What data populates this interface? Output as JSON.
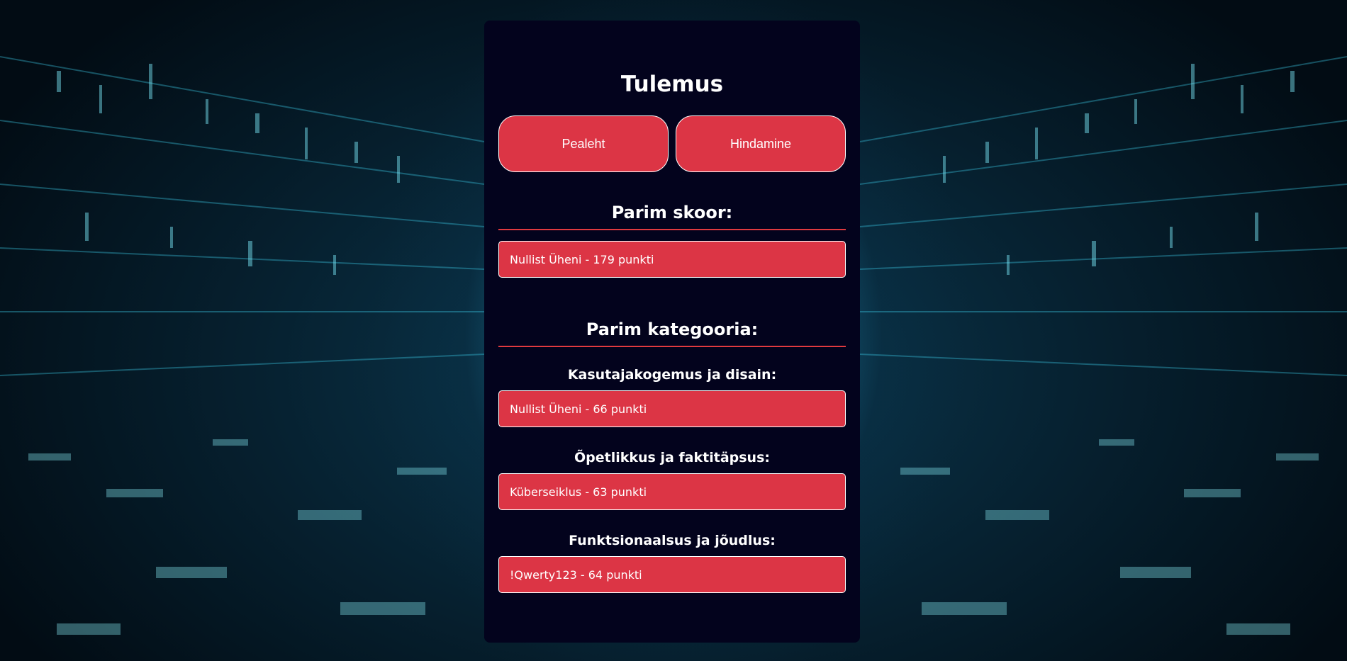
{
  "page": {
    "title": "Tulemus"
  },
  "nav": {
    "home_label": "Pealeht",
    "rating_label": "Hindamine"
  },
  "best_score": {
    "heading": "Parim skoor:",
    "result": "Nullist Üheni - 179 punkti"
  },
  "best_category": {
    "heading": "Parim kategooria:",
    "categories": [
      {
        "label": "Kasutajakogemus ja disain:",
        "result": "Nullist Üheni - 66 punkti"
      },
      {
        "label": "Õpetlikkus ja faktitäpsus:",
        "result": "Küberseiklus - 63 punkti"
      },
      {
        "label": "Funktsionaalsus ja jõudlus:",
        "result": "!Qwerty123 - 64 punkti"
      }
    ]
  },
  "colors": {
    "accent": "#dc3545",
    "card_background": "#03031d",
    "text": "#ffffff"
  }
}
